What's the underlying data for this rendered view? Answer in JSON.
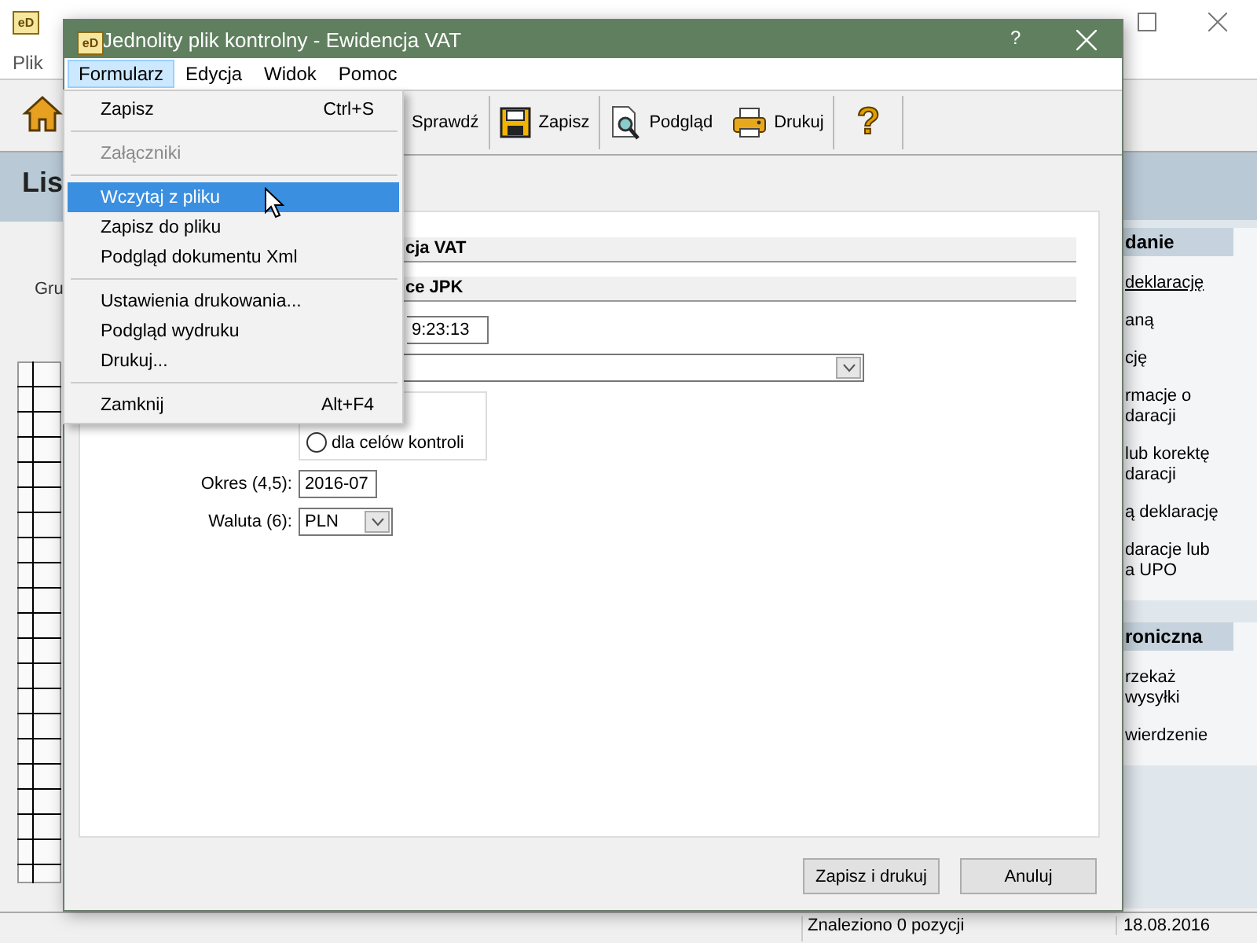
{
  "background_window": {
    "app_icon": "eD",
    "menu": [
      "Plik"
    ],
    "heading": "Lis",
    "filter_label": "Gru",
    "panel_sections": [
      {
        "title": "danie",
        "items": [
          {
            "lines": [
              "deklarację"
            ],
            "underlined": true
          },
          {
            "lines": [
              "aną"
            ],
            "underlined": false
          },
          {
            "lines": [
              "cję"
            ],
            "underlined": false
          },
          {
            "lines": [
              "rmacje o",
              "daracji"
            ],
            "underlined": false
          },
          {
            "lines": [
              "lub korektę",
              "daracji"
            ],
            "underlined": false
          },
          {
            "lines": [
              "ą deklarację"
            ],
            "underlined": false
          },
          {
            "lines": [
              "daracje lub",
              "a UPO"
            ],
            "underlined": false
          }
        ]
      },
      {
        "title": "roniczna",
        "items": [
          {
            "lines": [
              "rzekaż",
              "wysyłki"
            ],
            "underlined": false
          },
          {
            "lines": [
              "wierdzenie"
            ],
            "underlined": false
          }
        ]
      }
    ],
    "status_bar": [
      "Znaleziono 0 pozycji",
      "18.08.2016"
    ]
  },
  "dialog": {
    "app_icon": "eD",
    "title": "Jednolity plik kontrolny - Ewidencja VAT",
    "help": "?",
    "menu": [
      {
        "label": "Formularz",
        "selected": true
      },
      {
        "label": "Edycja",
        "selected": false
      },
      {
        "label": "Widok",
        "selected": false
      },
      {
        "label": "Pomoc",
        "selected": false
      }
    ],
    "toolbar": [
      {
        "kind": "text",
        "label": "Sprawdź"
      },
      {
        "kind": "save",
        "label": "Zapisz"
      },
      {
        "kind": "preview",
        "label": "Podgląd"
      },
      {
        "kind": "print",
        "label": "Drukuj"
      },
      {
        "kind": "help",
        "label": "?"
      }
    ],
    "dropdown": [
      {
        "kind": "item",
        "label": "Zapisz",
        "shortcut": "Ctrl+S",
        "disabled": false,
        "selected": false
      },
      {
        "kind": "separator"
      },
      {
        "kind": "item",
        "label": "Załączniki",
        "disabled": true,
        "selected": false
      },
      {
        "kind": "separator"
      },
      {
        "kind": "item",
        "label": "Wczytaj z pliku",
        "disabled": false,
        "selected": true
      },
      {
        "kind": "item",
        "label": "Zapisz do pliku",
        "disabled": false,
        "selected": false
      },
      {
        "kind": "item",
        "label": "Podgląd dokumentu Xml",
        "disabled": false,
        "selected": false
      },
      {
        "kind": "separator"
      },
      {
        "kind": "item",
        "label": "Ustawienia drukowania...",
        "disabled": false,
        "selected": false
      },
      {
        "kind": "item",
        "label": "Podgląd wydruku",
        "disabled": false,
        "selected": false
      },
      {
        "kind": "item",
        "label": "Drukuj...",
        "disabled": false,
        "selected": false
      },
      {
        "kind": "separator"
      },
      {
        "kind": "item",
        "label": "Zamknij",
        "shortcut": "Alt+F4",
        "disabled": false,
        "selected": false
      }
    ],
    "form": {
      "section_headers": [
        "cja VAT",
        "ce JPK"
      ],
      "time_value": "9:23:13",
      "radio": {
        "label": "dla celów kontroli",
        "selected": false
      },
      "period": {
        "label": "Okres (4,5):",
        "value": "2016-07"
      },
      "currency": {
        "label": "Waluta (6):",
        "value": "PLN"
      }
    },
    "buttons": [
      "Zapisz i drukuj",
      "Anuluj"
    ]
  }
}
